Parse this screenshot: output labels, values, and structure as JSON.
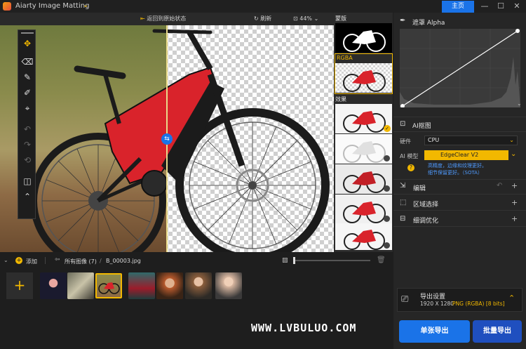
{
  "titlebar": {
    "app_title": "Aiarty Image Matting",
    "home_label": "主页",
    "minimize": "—",
    "maximize": "☐",
    "close": "✕"
  },
  "canvas_toolbar": {
    "revert_label": "返回到原始状态",
    "refresh_label": "刷新",
    "zoom_value": "44%"
  },
  "thumbnails": {
    "mask_label": "蒙版",
    "rgba_label": "RGBA",
    "effects_label": "效果"
  },
  "right_panel": {
    "mask_alpha_title": "遮罩 Alpha",
    "ai_matting_title": "AI抠图",
    "hardware_label": "硬件",
    "hardware_value": "CPU",
    "ai_model_label": "AI 模型",
    "ai_model_value": "EdgeClear  V2",
    "model_desc_line1": "高精度，边缘和纹理更好。",
    "model_desc_line2": "细节保留更好。（SOTA）",
    "edit_title": "编辑",
    "region_title": "区域选择",
    "refine_title": "细调优化"
  },
  "bottom": {
    "add_label": "添加",
    "all_images_label": "所有图像 (7)",
    "separator": "/",
    "current_file": "B_00003.jpg"
  },
  "export": {
    "settings_title": "导出设置",
    "resolution": "1920 X 1280",
    "format": "PNG (RGBA) [8 bits]",
    "single_export": "单张导出",
    "batch_export": "批量导出"
  },
  "watermark": "WWW.LVBULUO.COM",
  "colors": {
    "accent_yellow": "#f2b800",
    "accent_blue": "#1a73e8",
    "bike_red": "#d9232b"
  }
}
